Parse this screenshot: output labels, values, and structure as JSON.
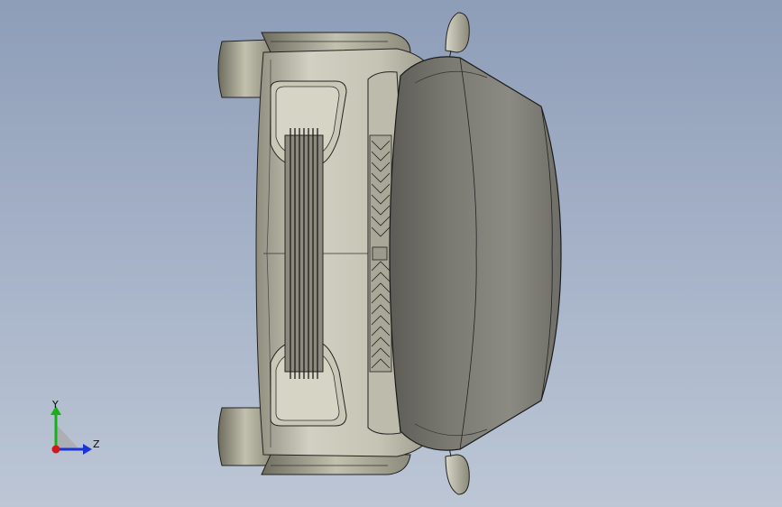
{
  "viewport": {
    "background_top": "#8e9db8",
    "background_bottom": "#bcc6d5"
  },
  "model": {
    "view": "top",
    "subject": "car front end",
    "body_color": "#7d7b72",
    "panel_color": "#b9b7a8",
    "edge_color": "#222222"
  },
  "triad": {
    "y_label": "Y",
    "z_label": "Z",
    "y_color": "#18b018",
    "z_color": "#1a35d6",
    "origin_color": "#d01818"
  }
}
